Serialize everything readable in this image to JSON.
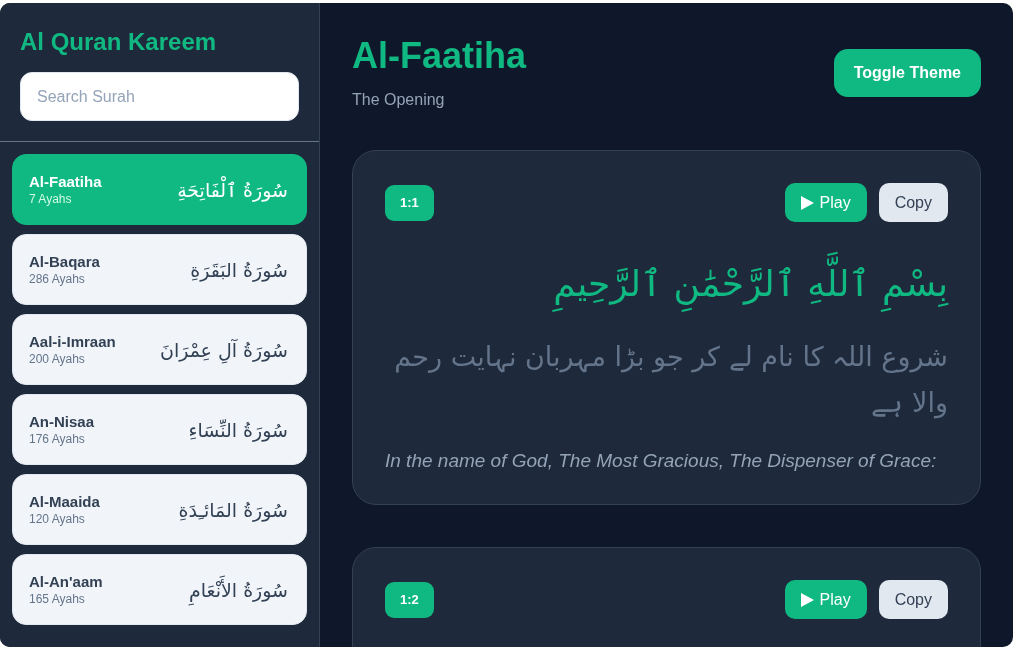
{
  "sidebar": {
    "title": "Al Quran Kareem",
    "search": {
      "placeholder": "Search Surah"
    },
    "surahs": [
      {
        "name": "Al-Faatiha",
        "ayahs": "7 Ayahs",
        "arabic": "سُورَةُ ٱلْفَاتِحَةِ",
        "selected": true
      },
      {
        "name": "Al-Baqara",
        "ayahs": "286 Ayahs",
        "arabic": "سُورَةُ البَقَرَةِ",
        "selected": false
      },
      {
        "name": "Aal-i-Imraan",
        "ayahs": "200 Ayahs",
        "arabic": "سُورَةُ آلِ عِمْرَانَ",
        "selected": false
      },
      {
        "name": "An-Nisaa",
        "ayahs": "176 Ayahs",
        "arabic": "سُورَةُ النِّسَاءِ",
        "selected": false
      },
      {
        "name": "Al-Maaida",
        "ayahs": "120 Ayahs",
        "arabic": "سُورَةُ المَائـِدَةِ",
        "selected": false
      },
      {
        "name": "Al-An'aam",
        "ayahs": "165 Ayahs",
        "arabic": "سُورَةُ الأَنْعَامِ",
        "selected": false
      }
    ]
  },
  "header": {
    "title": "Al-Faatiha",
    "subtitle": "The Opening",
    "toggle_button": "Toggle Theme"
  },
  "ayahs": [
    {
      "number": "1:1",
      "play_button": "Play",
      "copy_button": "Copy",
      "arabic": "بِسْمِ ٱللَّهِ ٱلرَّحْمَٰنِ ٱلرَّحِيمِ",
      "urdu": "شروع اللہ کا نام لے کر جو بڑا مہربان نہایت رحم والا ہے",
      "english": "In the name of God, The Most Gracious, The Dispenser of Grace:"
    },
    {
      "number": "1:2",
      "play_button": "Play",
      "copy_button": "Copy"
    }
  ]
}
